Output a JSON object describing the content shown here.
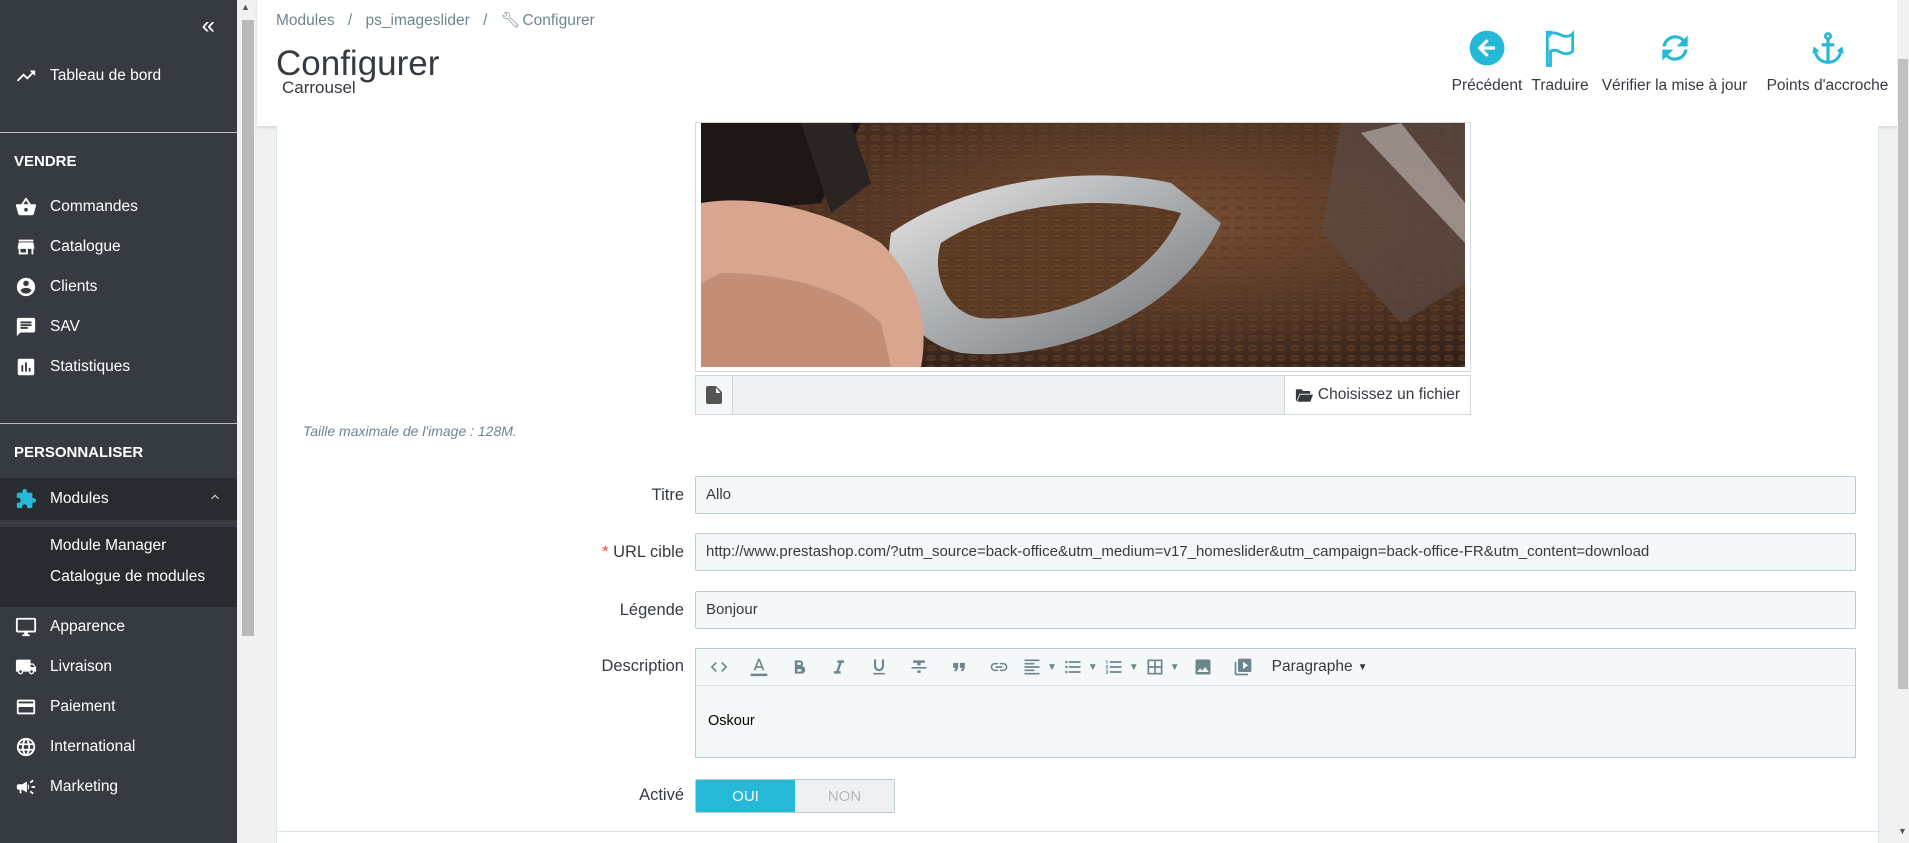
{
  "sidebar": {
    "collapse_label": "«",
    "dashboard": "Tableau de bord",
    "section_sell": "VENDRE",
    "sell_items": [
      {
        "label": "Commandes",
        "icon": "basket-icon"
      },
      {
        "label": "Catalogue",
        "icon": "store-icon"
      },
      {
        "label": "Clients",
        "icon": "account-icon"
      },
      {
        "label": "SAV",
        "icon": "chat-icon"
      },
      {
        "label": "Statistiques",
        "icon": "bar-chart-icon"
      }
    ],
    "section_customize": "PERSONNALISER",
    "modules": "Modules",
    "modules_sub": [
      "Module Manager",
      "Catalogue de modules"
    ],
    "customize_items": [
      {
        "label": "Apparence",
        "icon": "monitor-icon"
      },
      {
        "label": "Livraison",
        "icon": "truck-icon"
      },
      {
        "label": "Paiement",
        "icon": "credit-card-icon"
      },
      {
        "label": "International",
        "icon": "globe-icon"
      },
      {
        "label": "Marketing",
        "icon": "megaphone-icon"
      }
    ]
  },
  "header": {
    "breadcrumb": [
      "Modules",
      "/",
      "ps_imageslider",
      "/",
      "Configurer"
    ],
    "title": "Configurer",
    "subtitle": "Carrousel",
    "toolbar": [
      {
        "label": "Précédent",
        "icon": "back-arrow-icon"
      },
      {
        "label": "Traduire",
        "icon": "flag-icon"
      },
      {
        "label": "Vérifier la mise à jour",
        "icon": "refresh-icon"
      },
      {
        "label": "Points d'accroche",
        "icon": "anchor-icon"
      }
    ]
  },
  "form": {
    "choose_file": "Choisissez un fichier",
    "help_text": "Taille maximale de l'image : 128M.",
    "title_label": "Titre",
    "title_value": "Allo",
    "url_required": "*",
    "url_label": "URL cible",
    "url_value": "http://www.prestashop.com/?utm_source=back-office&utm_medium=v17_homeslider&utm_campaign=back-office-FR&utm_content=download",
    "legend_label": "Légende",
    "legend_value": "Bonjour",
    "description_label": "Description",
    "paragraph_label": "Paragraphe",
    "description_value": "Oskour",
    "active_label": "Activé",
    "yes": "OUI",
    "no": "NON"
  },
  "colors": {
    "accent": "#25b9d7",
    "sidebar_bg": "#363a41"
  }
}
